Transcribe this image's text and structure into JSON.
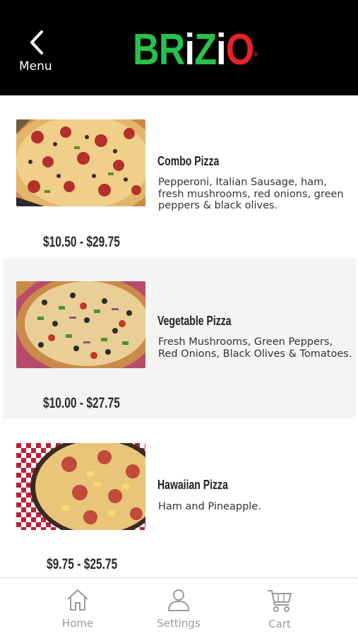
{
  "header": {
    "back_label": "Menu",
    "logo_text": "BRiZiO",
    "logo_colors": {
      "green": "#28c24a",
      "white": "#ffffff",
      "red": "#e8212a"
    }
  },
  "menu": {
    "items": [
      {
        "name": "Combo Pizza",
        "description": "Pepperoni, Italian Sausage, ham, fresh mushrooms, red onions, green peppers & black olives.",
        "price": "$10.50 - $29.75",
        "image_icon": "combo-pizza-photo"
      },
      {
        "name": "Vegetable Pizza",
        "description": "Fresh Mushrooms, Green Peppers, Red Onions, Black Olives & Tomatoes.",
        "price": "$10.00 - $27.75",
        "image_icon": "vegetable-pizza-photo"
      },
      {
        "name": "Hawaiian Pizza",
        "description": "Ham and Pineapple.",
        "price": "$9.75 - $25.75",
        "image_icon": "hawaiian-pizza-photo"
      }
    ]
  },
  "tabbar": {
    "tabs": [
      {
        "label": "Home",
        "icon": "home-icon"
      },
      {
        "label": "Settings",
        "icon": "user-icon"
      },
      {
        "label": "Cart",
        "icon": "cart-icon"
      }
    ]
  }
}
